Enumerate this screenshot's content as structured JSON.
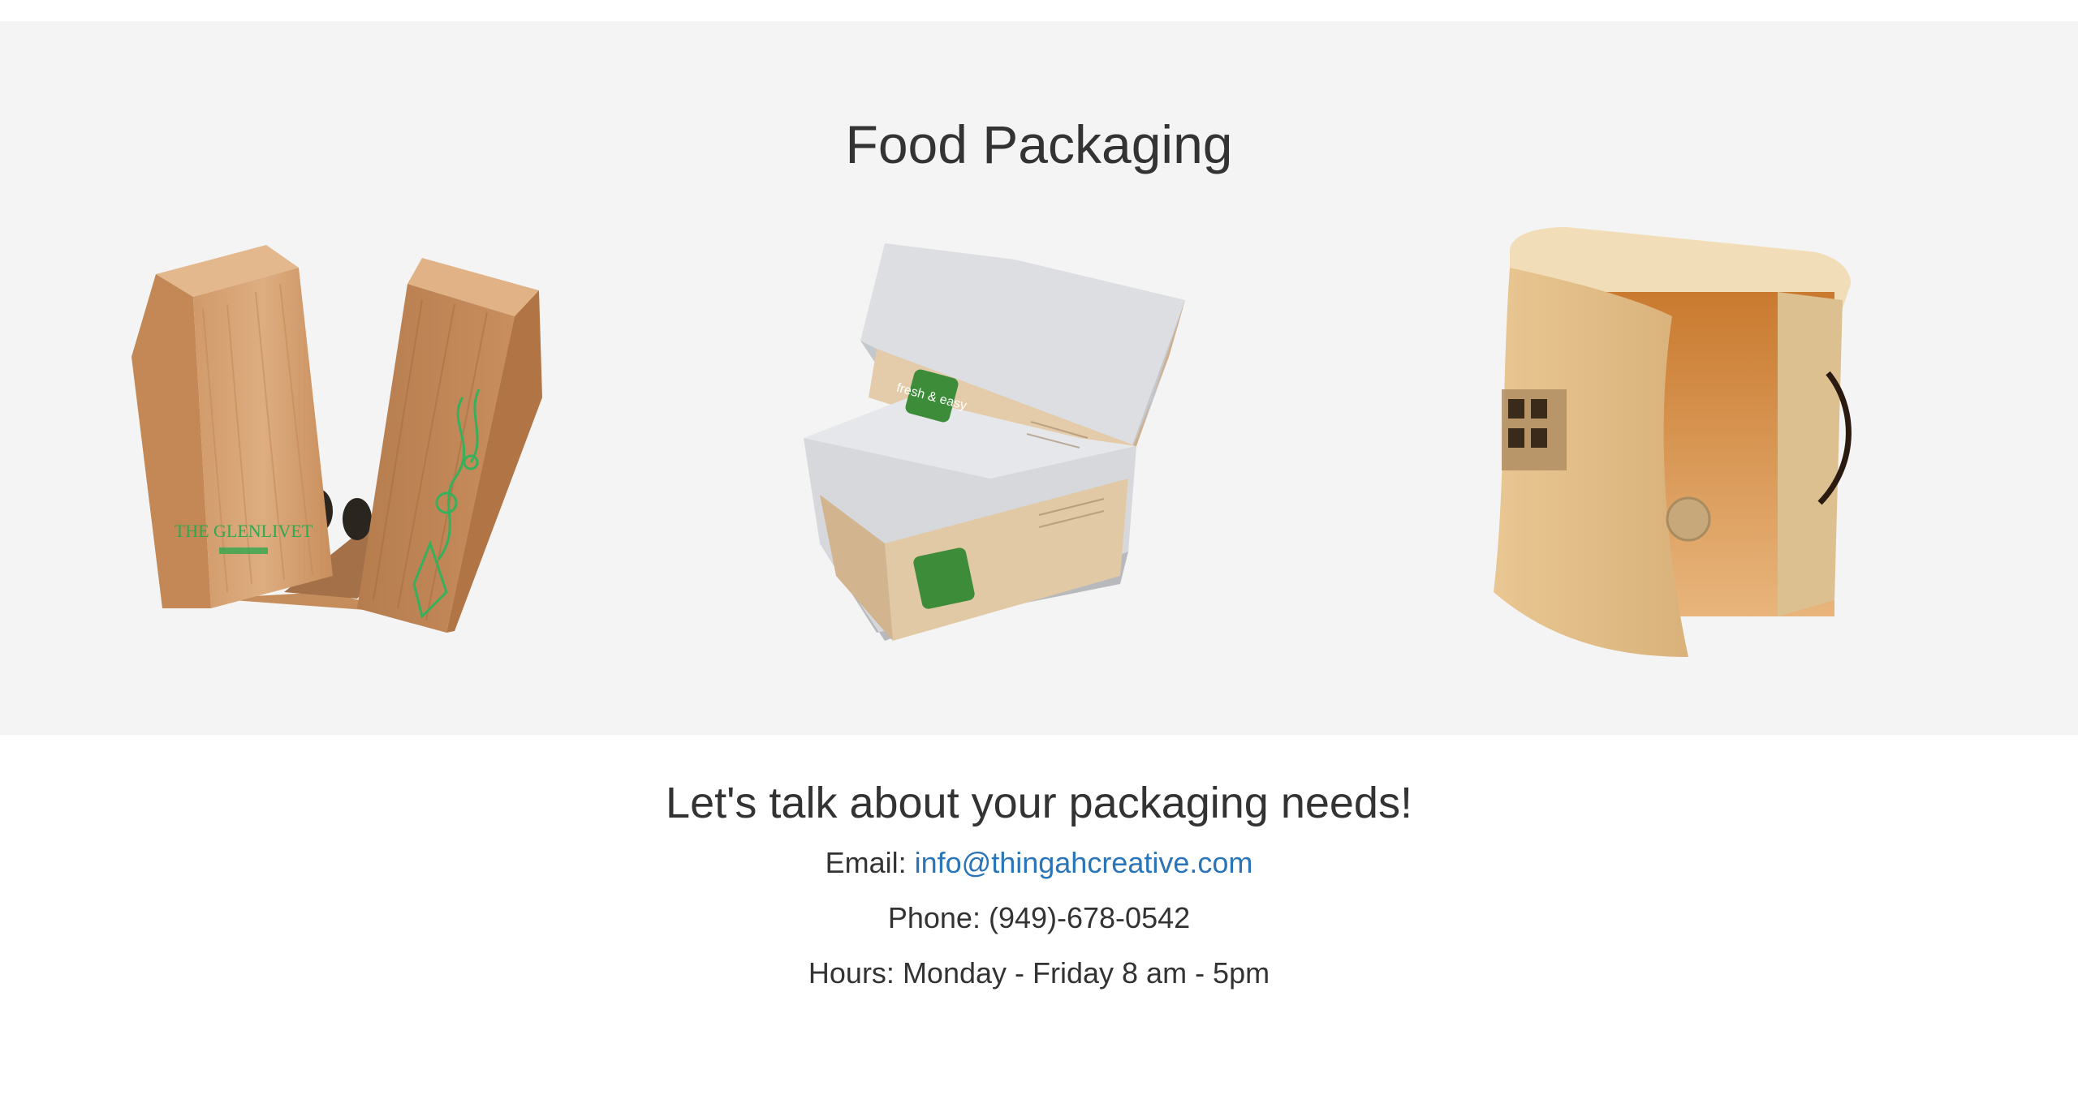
{
  "gallery": {
    "title": "Food Packaging",
    "products": [
      {
        "name": "whisky-gift-box",
        "icon": "glenlivet-box-image",
        "brand": "THE GLENLIVET"
      },
      {
        "name": "paper-food-trays",
        "icon": "food-tray-image",
        "brand": "fresh & easy"
      },
      {
        "name": "wooden-box",
        "icon": "wooden-box-image"
      }
    ]
  },
  "contact": {
    "heading": "Let's talk about your packaging needs!",
    "email_label": "Email: ",
    "email_value": "info@thingahcreative.com",
    "phone": "Phone: (949)-678-0542",
    "hours": "Hours: Monday - Friday 8 am - 5pm"
  },
  "colors": {
    "gallery_bg": "#f4f4f4",
    "text": "#333333",
    "link": "#2a74b8",
    "brand_green": "#2fa84f"
  }
}
